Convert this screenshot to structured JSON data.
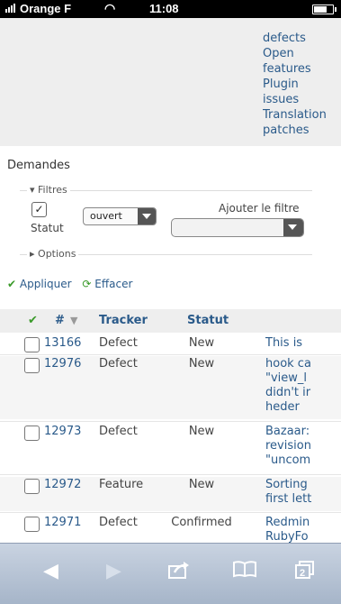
{
  "status_bar": {
    "carrier": "Orange F",
    "time": "11:08"
  },
  "queries": [
    "defects",
    "Open",
    "features",
    "Plugin",
    "issues",
    "Translation",
    "patches"
  ],
  "page": {
    "title": "Demandes",
    "filters_legend": "Filtres",
    "statut_label": "Statut",
    "statut_value": "ouvert",
    "add_filter_label": "Ajouter le filtre",
    "options_legend": "Options",
    "apply": "Appliquer",
    "clear": "Effacer"
  },
  "table": {
    "headers": {
      "id": "#",
      "tracker": "Tracker",
      "status": "Statut"
    },
    "rows": [
      {
        "id": "13166",
        "tracker": "Defect",
        "status": "New",
        "subject": "This is a"
      },
      {
        "id": "12976",
        "tracker": "Defect",
        "status": "New",
        "subject": "hook ca \"view_l didn't ir heder"
      },
      {
        "id": "12973",
        "tracker": "Defect",
        "status": "New",
        "subject": "Bazaar: revision \"uncom"
      },
      {
        "id": "12972",
        "tracker": "Feature",
        "status": "New",
        "subject": "Sorting first lett"
      },
      {
        "id": "12971",
        "tracker": "Defect",
        "status": "Confirmed",
        "subject": "Redmin RubyFo version"
      }
    ]
  },
  "toolbar": {
    "tabs_count": "2"
  },
  "icons": [
    "back-icon",
    "forward-icon",
    "share-icon",
    "bookmarks-icon",
    "tabs-icon"
  ],
  "colors": {
    "link": "#2a5a8a",
    "toolbar": "#b4c1d3",
    "apply_icon": "#3a9a2a"
  }
}
